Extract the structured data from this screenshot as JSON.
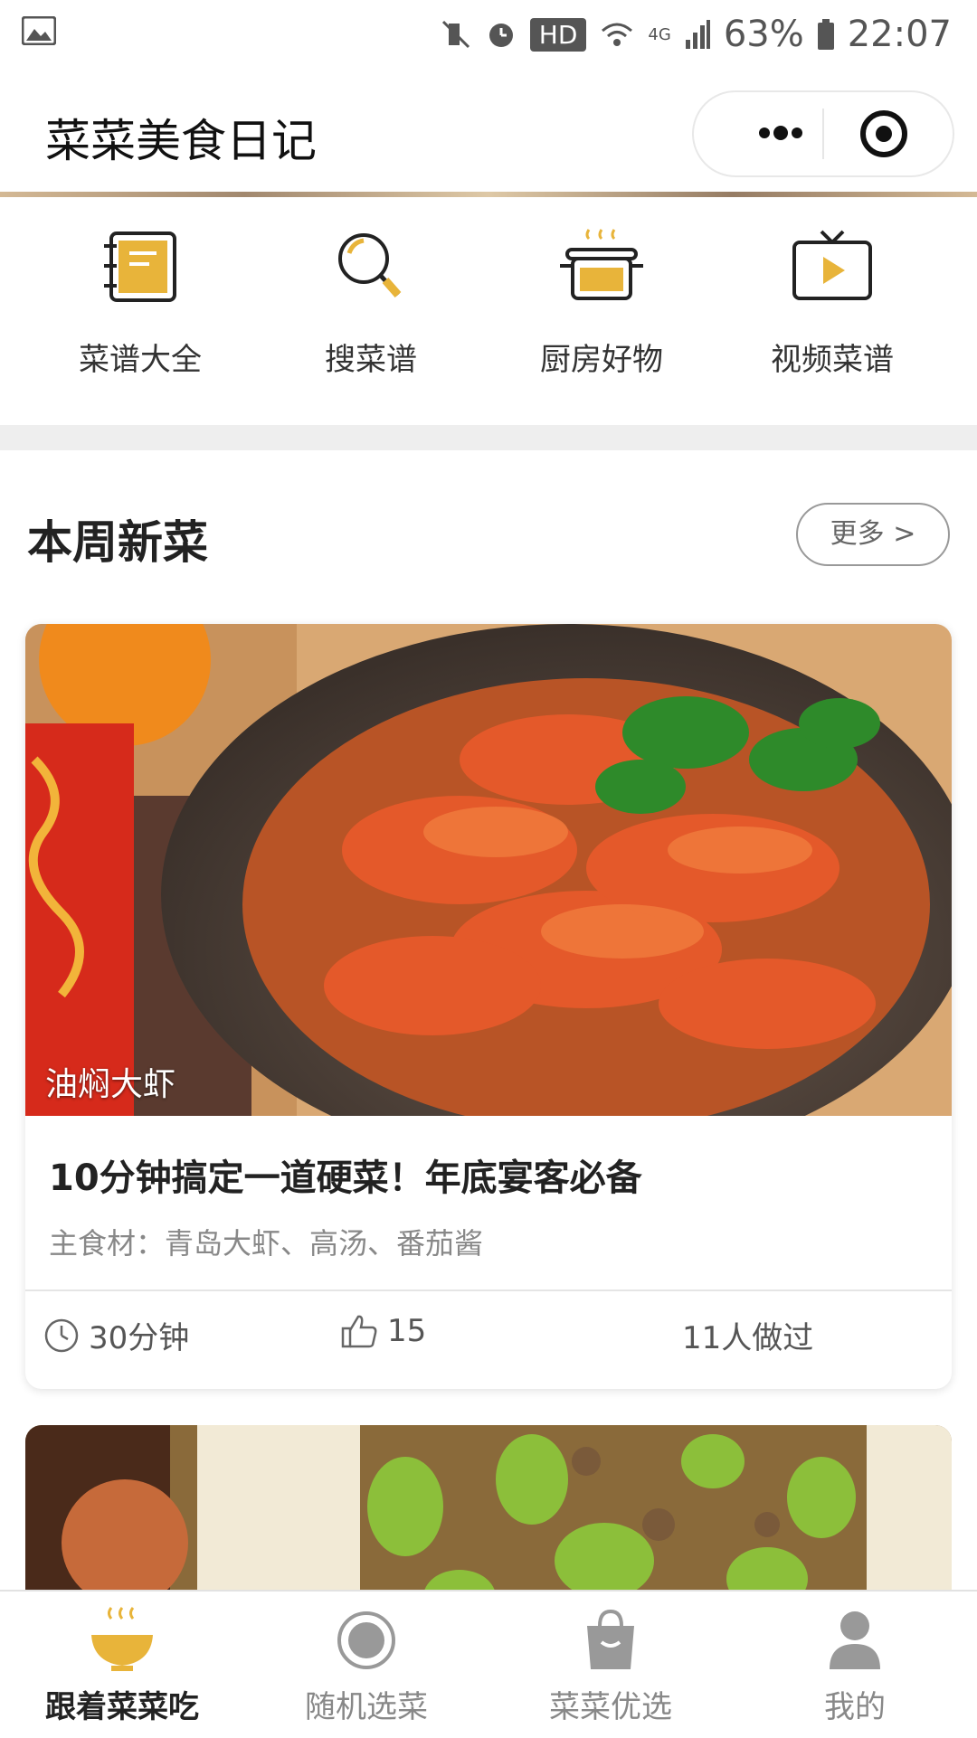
{
  "status_bar": {
    "hd": "HD",
    "net": "4G",
    "battery": "63%",
    "time": "22:07"
  },
  "header": {
    "title": "菜菜美食日记"
  },
  "quick_nav": [
    {
      "label": "菜谱大全",
      "icon": "recipe-book-icon"
    },
    {
      "label": "搜菜谱",
      "icon": "search-icon"
    },
    {
      "label": "厨房好物",
      "icon": "cooking-pot-icon"
    },
    {
      "label": "视频菜谱",
      "icon": "tv-video-icon"
    }
  ],
  "section": {
    "title": "本周新菜",
    "more_label": "更多 >"
  },
  "card": {
    "image_caption": "油焖大虾",
    "title": "10分钟搞定一道硬菜！年底宴客必备",
    "ingredients": "主食材：青岛大虾、高汤、番茄酱",
    "time": "30分钟",
    "likes": "15",
    "made": "11人做过"
  },
  "tabs": [
    {
      "label": "跟着菜菜吃",
      "icon": "steaming-bowl-icon",
      "active": true
    },
    {
      "label": "随机选菜",
      "icon": "random-dot-icon",
      "active": false
    },
    {
      "label": "菜菜优选",
      "icon": "shopping-bag-icon",
      "active": false
    },
    {
      "label": "我的",
      "icon": "user-icon",
      "active": false
    }
  ],
  "colors": {
    "accent": "#e8b43a",
    "text": "#222222",
    "muted": "#888888"
  }
}
